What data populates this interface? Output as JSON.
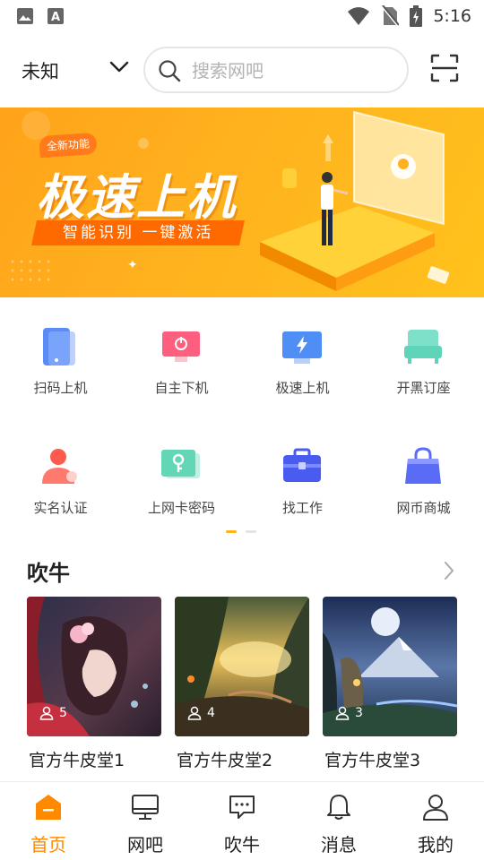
{
  "status_bar": {
    "time": "5:16"
  },
  "header": {
    "location": "未知",
    "search_placeholder": "搜索网吧"
  },
  "banner": {
    "badge": "全新功能",
    "title": "极速上机",
    "subtitle": "智能识别 一键激活"
  },
  "grid": {
    "items": [
      {
        "label": "扫码上机",
        "icon": "phone-scan-icon"
      },
      {
        "label": "自主下机",
        "icon": "power-off-icon"
      },
      {
        "label": "极速上机",
        "icon": "lightning-monitor-icon"
      },
      {
        "label": "开黑订座",
        "icon": "seat-icon"
      },
      {
        "label": "实名认证",
        "icon": "user-verify-icon"
      },
      {
        "label": "上网卡密码",
        "icon": "key-card-icon"
      },
      {
        "label": "找工作",
        "icon": "briefcase-icon"
      },
      {
        "label": "网币商城",
        "icon": "shopping-bag-icon"
      }
    ]
  },
  "section": {
    "title": "吹牛",
    "cards": [
      {
        "title": "官方牛皮堂1",
        "count": "5"
      },
      {
        "title": "官方牛皮堂2",
        "count": "4"
      },
      {
        "title": "官方牛皮堂3",
        "count": "3"
      }
    ]
  },
  "bottom_nav": {
    "items": [
      {
        "label": "首页",
        "icon": "home-icon",
        "active": true
      },
      {
        "label": "网吧",
        "icon": "monitor-icon",
        "active": false
      },
      {
        "label": "吹牛",
        "icon": "chat-icon",
        "active": false
      },
      {
        "label": "消息",
        "icon": "bell-icon",
        "active": false
      },
      {
        "label": "我的",
        "icon": "profile-icon",
        "active": false
      }
    ]
  },
  "colors": {
    "accent": "#ff8a00",
    "banner": "#ffb21e"
  }
}
